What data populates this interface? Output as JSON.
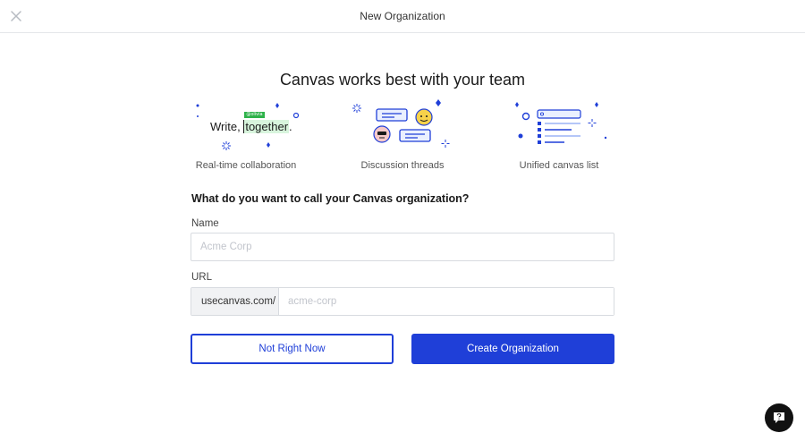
{
  "header": {
    "title": "New Organization",
    "close_icon": "close-icon"
  },
  "headline": "Canvas works best with your team",
  "features": [
    {
      "label": "Real-time collaboration",
      "illustration": {
        "word_plain": "Write,",
        "word_highlight": "together",
        "trailing": ".",
        "tag": "@olivia"
      }
    },
    {
      "label": "Discussion threads"
    },
    {
      "label": "Unified canvas list"
    }
  ],
  "form": {
    "question": "What do you want to call your Canvas organization?",
    "name_label": "Name",
    "name_placeholder": "Acme Corp",
    "name_value": "",
    "url_label": "URL",
    "url_prefix": "usecanvas.com/",
    "url_placeholder": "acme-corp",
    "url_value": ""
  },
  "buttons": {
    "secondary": "Not Right Now",
    "primary": "Create Organization"
  },
  "help": {
    "icon": "chat-help-icon"
  },
  "colors": {
    "accent": "#1f3fd8",
    "highlight_green": "#2eb24a",
    "border": "#d8dbe0"
  }
}
